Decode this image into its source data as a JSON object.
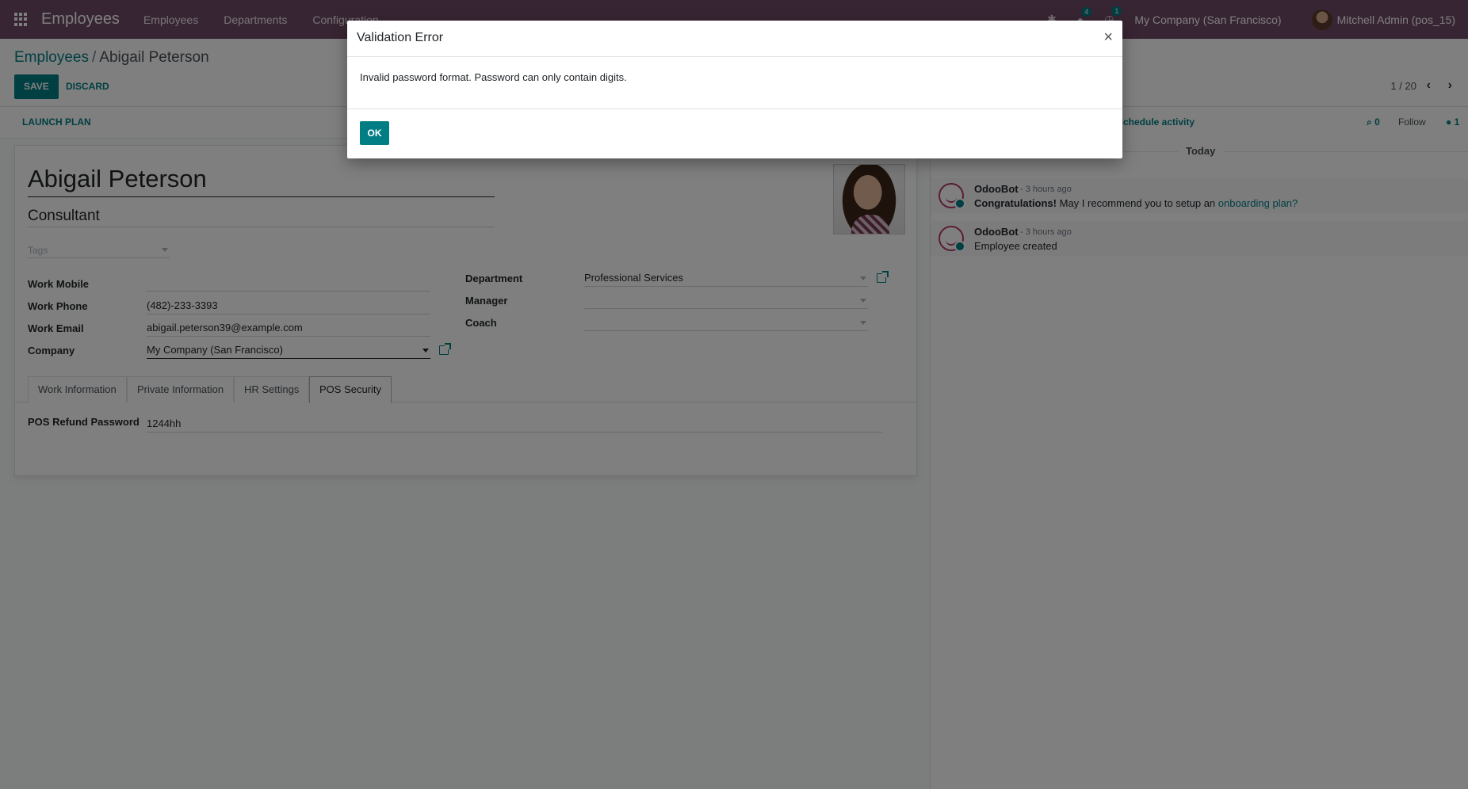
{
  "topnav": {
    "app_title": "Employees",
    "menu": [
      "Employees",
      "Departments",
      "Configuration"
    ],
    "messages_badge": "4",
    "activities_badge": "1",
    "company": "My Company (San Francisco)",
    "user": "Mitchell Admin (pos_15)"
  },
  "control_panel": {
    "breadcrumb_parent": "Employees",
    "breadcrumb_separator": "/",
    "breadcrumb_current": "Abigail Peterson",
    "save_label": "SAVE",
    "discard_label": "DISCARD",
    "pager": "1 / 20"
  },
  "statusbar": {
    "launch_plan_label": "LAUNCH PLAN"
  },
  "form": {
    "name": "Abigail Peterson",
    "job_title": "Consultant",
    "tags_placeholder": "Tags",
    "left_fields": [
      {
        "label": "Work Mobile",
        "value": ""
      },
      {
        "label": "Work Phone",
        "value": "(482)-233-3393"
      },
      {
        "label": "Work Email",
        "value": "abigail.peterson39@example.com"
      },
      {
        "label": "Company",
        "value": "My Company (San Francisco)"
      }
    ],
    "right_fields": [
      {
        "label": "Department",
        "value": "Professional Services"
      },
      {
        "label": "Manager",
        "value": ""
      },
      {
        "label": "Coach",
        "value": ""
      }
    ],
    "tabs": [
      "Work Information",
      "Private Information",
      "HR Settings",
      "POS Security"
    ],
    "active_tab": "POS Security",
    "pos_refund_label": "POS Refund Password",
    "pos_refund_value": "1244hh"
  },
  "chatter": {
    "schedule_activity": "Schedule activity",
    "attachments_count": "0",
    "follow_label": "Follow",
    "followers_count": "1",
    "date_separator": "Today",
    "messages": [
      {
        "author": "OdooBot",
        "time": "- 3 hours ago",
        "body_bold": "Congratulations!",
        "body": " May I recommend you to setup an ",
        "link": "onboarding plan?"
      },
      {
        "author": "OdooBot",
        "time": "- 3 hours ago",
        "body_bold": "",
        "body": "Employee created",
        "link": ""
      }
    ]
  },
  "dialog": {
    "title": "Validation Error",
    "close_symbol": "×",
    "message": "Invalid password format. Password can only contain digits.",
    "ok_label": "OK"
  },
  "colors": {
    "brand": "#714B67",
    "accent": "#017e84"
  }
}
